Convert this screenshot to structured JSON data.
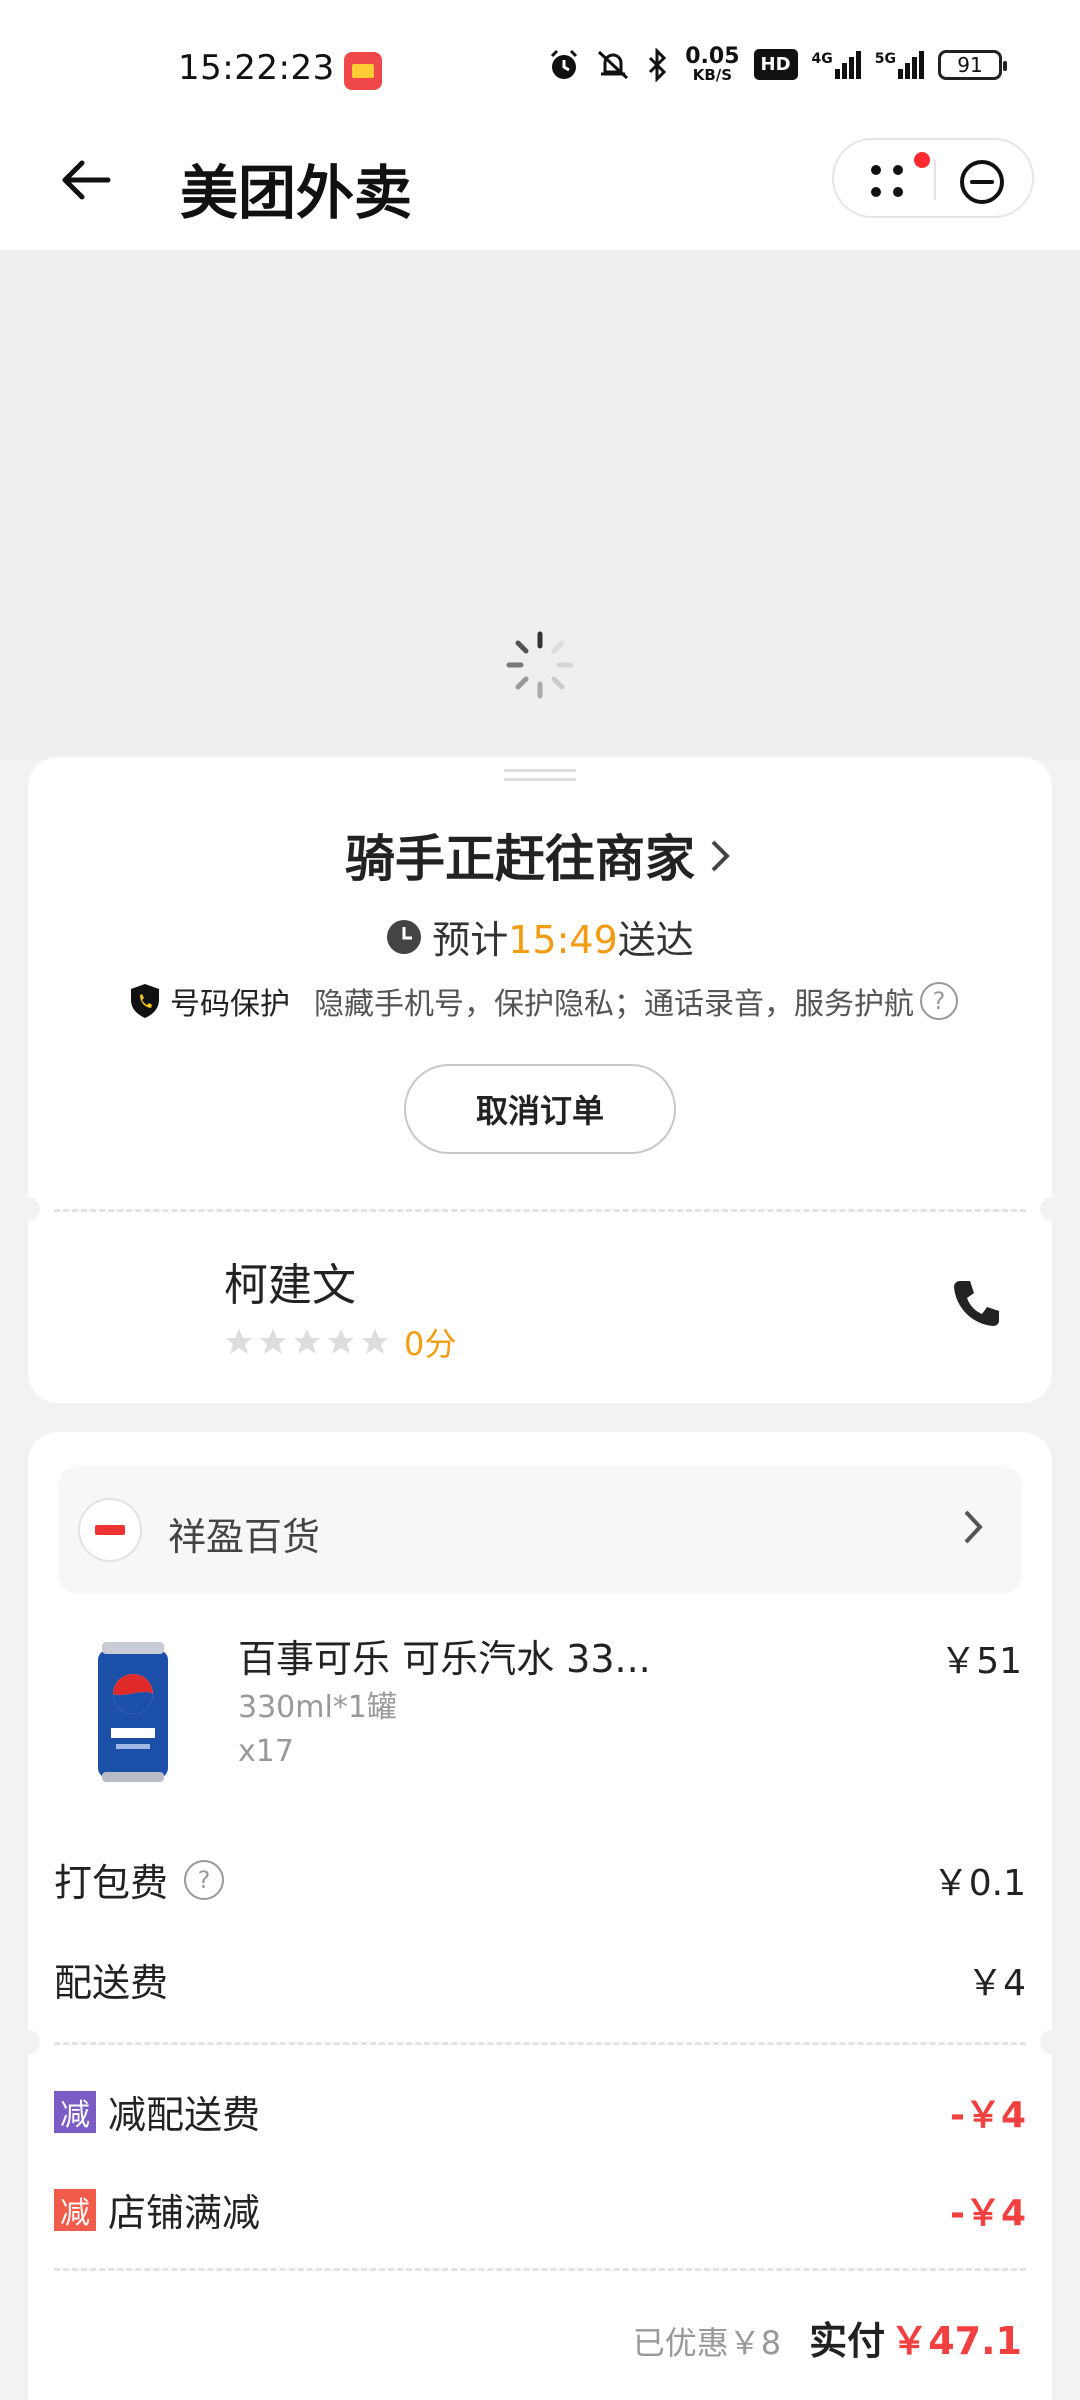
{
  "status_bar": {
    "time": "15:22:23",
    "net_speed_value": "0.05",
    "net_speed_unit": "KB/S",
    "hd_label": "HD",
    "network_4g": "4G",
    "network_5g": "5G",
    "battery": "91"
  },
  "header": {
    "title": "美团外卖"
  },
  "order_status": {
    "headline": "骑手正赶往商家",
    "eta_prefix": "预计",
    "eta_time": "15:49",
    "eta_suffix": "送达",
    "privacy_title": "号码保护",
    "privacy_desc": "隐藏手机号，保护隐私；通话录音，服务护航",
    "help_symbol": "?",
    "cancel_label": "取消订单"
  },
  "rider": {
    "name": "柯建文",
    "rating_text": "0分",
    "stars_filled": 0,
    "stars_total": 5
  },
  "order": {
    "shop_name": "祥盈百货",
    "item": {
      "name": "百事可乐 可乐汽水 33...",
      "spec": "330ml*1罐",
      "qty": "x17",
      "price": "￥51"
    },
    "fees": [
      {
        "label": "打包费",
        "value": "￥0.1",
        "has_help": true
      },
      {
        "label": "配送费",
        "value": "￥4",
        "has_help": false
      }
    ],
    "discounts": [
      {
        "tag": "减",
        "label": "减配送费",
        "value": "-￥4",
        "tag_color": "#7b5bc4"
      },
      {
        "tag": "减",
        "label": "店铺满减",
        "value": "-￥4",
        "tag_color": "#f25a4a"
      }
    ],
    "saved_text": "已优惠￥8",
    "paid_label": "实付",
    "paid_value": "￥47.1"
  },
  "colors": {
    "accent_orange": "#f39c12",
    "price_red": "#f04040",
    "notification_red": "#ff2d2d"
  }
}
